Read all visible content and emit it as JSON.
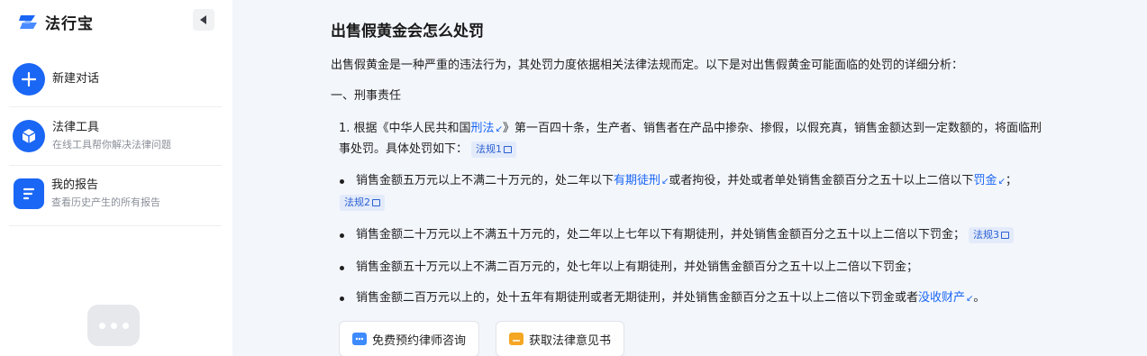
{
  "app": {
    "name": "法行宝"
  },
  "sidebar": {
    "new_chat": {
      "label": "新建对话"
    },
    "items": [
      {
        "title": "法律工具",
        "subtitle": "在线工具帮你解决法律问题"
      },
      {
        "title": "我的报告",
        "subtitle": "查看历史产生的所有报告"
      }
    ]
  },
  "main": {
    "title": "出售假黄金会怎么处罚",
    "intro": "出售假黄金是一种严重的违法行为，其处罚力度依据相关法律法规而定。以下是对出售假黄金可能面临的处罚的详细分析：",
    "section1": "一、刑事责任",
    "point1": {
      "pre": "1. 根据《中华人民共和国",
      "link": "刑法",
      "post": "》第一百四十条，生产者、销售者在产品中掺杂、掺假，以假充真，销售金额达到一定数额的，将面临刑",
      "line2": "事处罚。具体处罚如下：",
      "tag": "法规1"
    },
    "bullets": [
      {
        "pre": "销售金额五万元以上不满二十万元的，处二年以下",
        "link1": "有期徒刑",
        "mid": "或者拘役，并处或者单处销售金额百分之五十以上二倍以下",
        "link2": "罚金",
        "post": "；",
        "tag": "法规2"
      },
      {
        "text": "销售金额二十万元以上不满五十万元的，处二年以上七年以下有期徒刑，并处销售金额百分之五十以上二倍以下罚金；",
        "tag": "法规3"
      },
      {
        "text": "销售金额五十万元以上不满二百万元的，处七年以上有期徒刑，并处销售金额百分之五十以上二倍以下罚金；"
      },
      {
        "pre": "销售金额二百万元以上的，处十五年有期徒刑或者无期徒刑，并处销售金额百分之五十以上二倍以下罚金或者",
        "link": "没收财产",
        "post": "。"
      }
    ],
    "actions": [
      {
        "label": "免费预约律师咨询"
      },
      {
        "label": "获取法律意见书"
      }
    ]
  },
  "colors": {
    "accent": "#1a66f5",
    "tag_bg": "#e3ebfb",
    "main_bg": "#f3f6fb"
  },
  "icons": [
    "logo-icon",
    "collapse-arrow-icon",
    "plus-icon",
    "cube-icon",
    "report-icon",
    "chat-bubble-icon",
    "law-link-arrow-icon",
    "document-icon",
    "message-icon",
    "folder-icon"
  ]
}
